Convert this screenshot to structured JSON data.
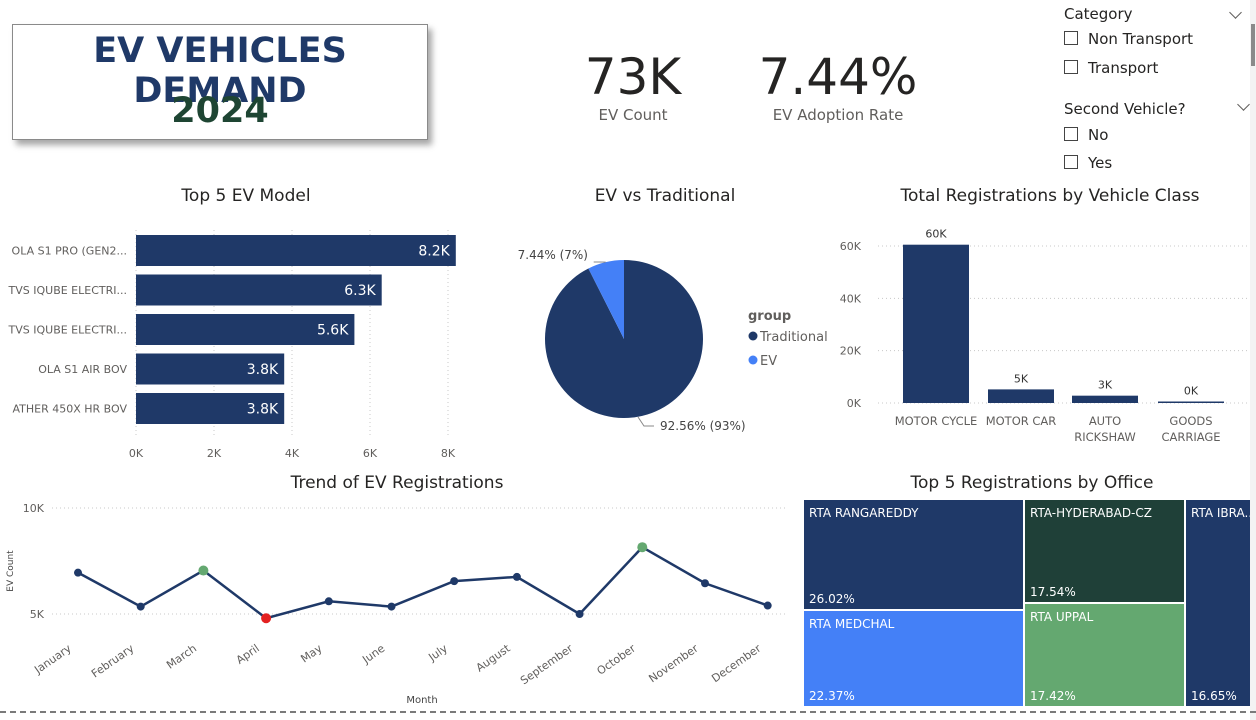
{
  "header": {
    "title_line1": "EV VEHICLES DEMAND",
    "title_line2": "2024"
  },
  "kpis": [
    {
      "value": "73K",
      "label": "EV Count"
    },
    {
      "value": "7.44%",
      "label": "EV Adoption Rate"
    }
  ],
  "slicers": {
    "category": {
      "title": "Category",
      "options": [
        "Non Transport",
        "Transport"
      ]
    },
    "second_vehicle": {
      "title": "Second Vehicle?",
      "options": [
        "No",
        "Yes"
      ]
    }
  },
  "visual_titles": {
    "top_models": "Top 5 EV Model",
    "ev_vs_traditional": "EV vs Traditional",
    "by_class": "Total Registrations by Vehicle Class",
    "trend": "Trend of EV Registrations",
    "by_office": "Top 5 Registrations by Office"
  },
  "colors": {
    "navy": "#1f3968",
    "blue": "#4480f7",
    "dark_green": "#1f4038",
    "green": "#64a870",
    "red": "#e32121"
  },
  "chart_data": [
    {
      "type": "bar",
      "orientation": "horizontal",
      "title": "Top 5 EV Model",
      "categories": [
        "OLA S1 PRO (GEN2...",
        "TVS IQUBE ELECTRI...",
        "TVS IQUBE ELECTRI...",
        "OLA S1 AIR BOV",
        "ATHER 450X HR BOV"
      ],
      "values": [
        8200,
        6300,
        5600,
        3800,
        3800
      ],
      "data_labels": [
        "8.2K",
        "6.3K",
        "5.6K",
        "3.8K",
        "3.8K"
      ],
      "xlim": [
        0,
        8500
      ],
      "xticks": [
        0,
        2000,
        4000,
        6000,
        8000
      ],
      "xtick_labels": [
        "0K",
        "2K",
        "4K",
        "6K",
        "8K"
      ],
      "grid": true
    },
    {
      "type": "pie",
      "title": "EV vs Traditional",
      "legend_title": "group",
      "legend_position": "right",
      "slices": [
        {
          "name": "Traditional",
          "value": 92.56,
          "label": "92.56% (93%)"
        },
        {
          "name": "EV",
          "value": 7.44,
          "label": "7.44% (7%)"
        }
      ]
    },
    {
      "type": "bar",
      "title": "Total Registrations by Vehicle Class",
      "categories": [
        "MOTOR CYCLE",
        "MOTOR CAR",
        "AUTO RICKSHAW",
        "GOODS CARRIAGE"
      ],
      "category_lines": [
        [
          "MOTOR CYCLE"
        ],
        [
          "MOTOR CAR"
        ],
        [
          "AUTO",
          "RICKSHAW"
        ],
        [
          "GOODS",
          "CARRIAGE"
        ]
      ],
      "values": [
        60500,
        5200,
        2800,
        300
      ],
      "data_labels": [
        "60K",
        "5K",
        "3K",
        "0K"
      ],
      "ylim": [
        0,
        65000
      ],
      "yticks": [
        0,
        20000,
        40000,
        60000
      ],
      "ytick_labels": [
        "0K",
        "20K",
        "40K",
        "60K"
      ],
      "grid": true
    },
    {
      "type": "line",
      "title": "Trend of EV Registrations",
      "xlabel": "Month",
      "ylabel": "EV Count",
      "x": [
        "January",
        "February",
        "March",
        "April",
        "May",
        "June",
        "July",
        "August",
        "September",
        "October",
        "November",
        "December"
      ],
      "values": [
        6950,
        5350,
        7050,
        4800,
        5600,
        5350,
        6550,
        6750,
        5000,
        8150,
        6450,
        5400
      ],
      "highlight": {
        "max_index": 9,
        "min_index": 3
      },
      "ylim": [
        4600,
        10000
      ],
      "yticks": [
        5000,
        10000
      ],
      "ytick_labels": [
        "5K",
        "10K"
      ],
      "grid": true
    },
    {
      "type": "treemap",
      "title": "Top 5 Registrations by Office",
      "items": [
        {
          "name": "RTA RANGAREDDY",
          "pct": 26.02,
          "label": "26.02%"
        },
        {
          "name": "RTA MEDCHAL",
          "pct": 22.37,
          "label": "22.37%"
        },
        {
          "name": "RTA-HYDERABAD-CZ",
          "pct": 17.54,
          "label": "17.54%"
        },
        {
          "name": "RTA UPPAL",
          "pct": 17.42,
          "label": "17.42%"
        },
        {
          "name": "RTA IBRA...",
          "pct": 16.65,
          "label": "16.65%"
        }
      ]
    }
  ]
}
